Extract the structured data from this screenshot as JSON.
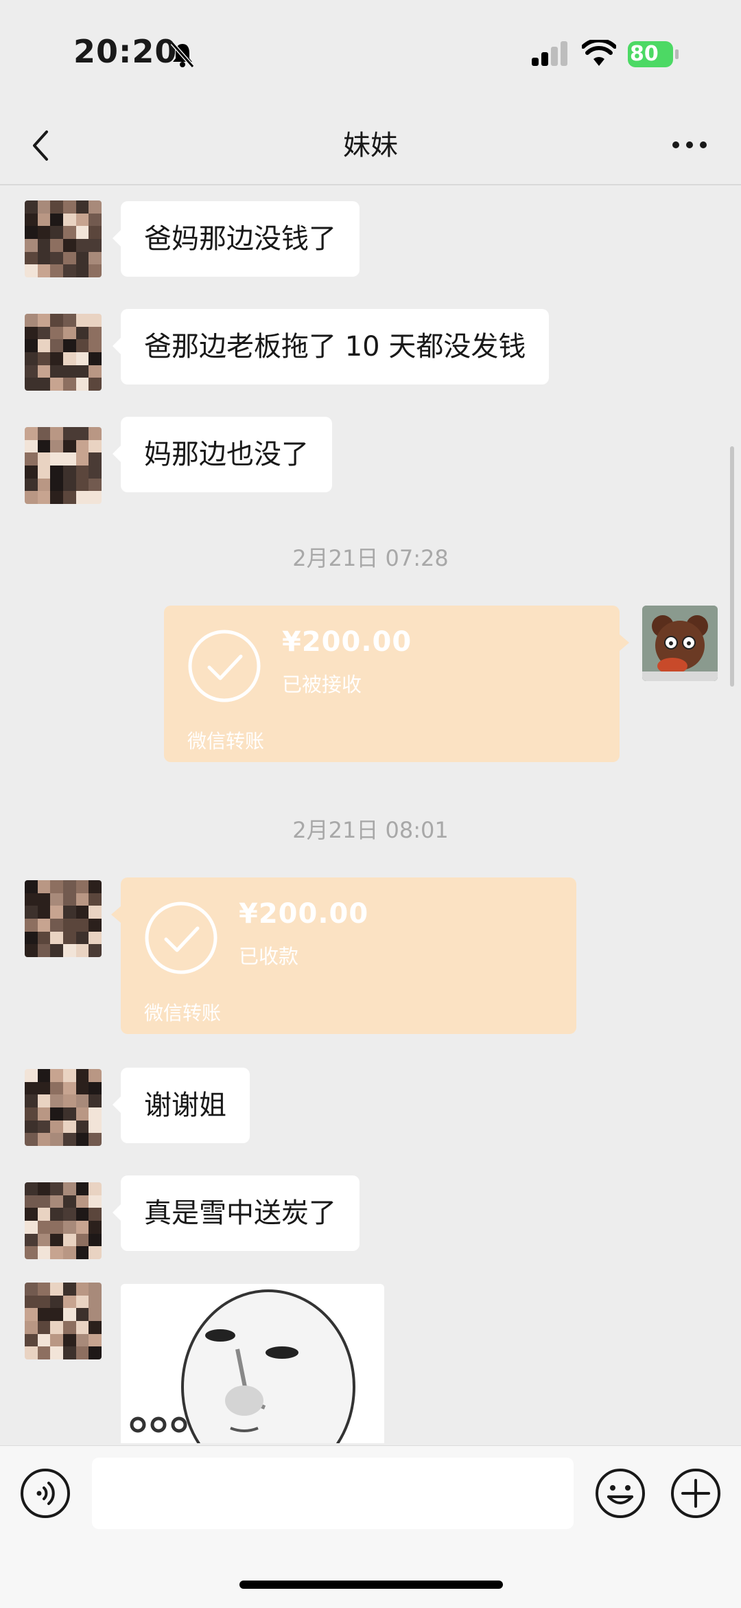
{
  "status_bar": {
    "time": "20:20",
    "battery": "80"
  },
  "nav": {
    "title": "妹妹"
  },
  "messages": {
    "m1": "爸妈那边没钱了",
    "m2": "爸那边老板拖了 10 天都没发钱",
    "m3": "妈那边也没了",
    "ts1": "2月21日 07:28",
    "transfer_sent": {
      "amount": "¥200.00",
      "status": "已被接收",
      "label": "微信转账"
    },
    "ts2": "2月21日 08:01",
    "transfer_received": {
      "amount": "¥200.00",
      "status": "已收款",
      "label": "微信转账"
    },
    "m4": "谢谢姐",
    "m5": "真是雪中送炭了"
  },
  "input": {
    "value": ""
  },
  "colors": {
    "transfer_bg": "#fbe2c3",
    "battery": "#4cd964",
    "background": "#ededed"
  }
}
